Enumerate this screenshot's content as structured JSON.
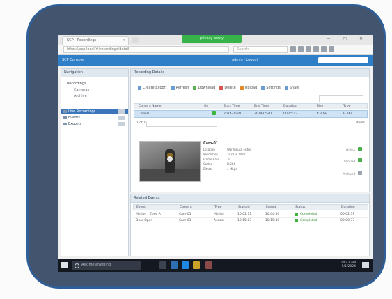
{
  "browser": {
    "tab_title": "SCP - Recordings",
    "tab_close": "×",
    "new_tab": "+",
    "proxy_label": "privacy proxy",
    "window_controls": "— ▢ ✕",
    "url": "https://scp.local/#/recordings/detail",
    "search_placeholder": "Search"
  },
  "app": {
    "logo": "SCP Console",
    "user": "admin · Logout",
    "colors": {
      "header": "#2f7fc8",
      "selection": "#3a76b9",
      "ok": "#3db53d"
    }
  },
  "sidebar": {
    "title": "Navigation",
    "tree_root": "Recordings",
    "tree_children": [
      "Cameras",
      "Archive"
    ],
    "items": [
      {
        "label": "Live Recordings",
        "active": true
      },
      {
        "label": "Events",
        "active": false
      },
      {
        "label": "Exports",
        "active": false
      }
    ]
  },
  "main": {
    "title": "Recording Details",
    "actions": [
      "Create Export",
      "Refresh",
      "Download",
      "Delete",
      "Upload",
      "Settings",
      "Share"
    ],
    "columns": [
      "Camera Name",
      "On",
      "Start Time",
      "End Time",
      "Duration",
      "Size",
      "Type"
    ],
    "row": [
      "Cam-01",
      "",
      "2024-05-01",
      "2024-05-01",
      "00:45:12",
      "4.2 GB",
      "H.264"
    ],
    "pager_label": "1 of 1",
    "pager_count": "1 items",
    "detail": {
      "title": "Cam-01",
      "fields": [
        [
          "Location",
          "Warehouse Entry"
        ],
        [
          "Resolution",
          "1920 × 1080"
        ],
        [
          "Frame Rate",
          "30"
        ],
        [
          "Codec",
          "H.264"
        ],
        [
          "Bitrate",
          "4 Mbps"
        ]
      ],
      "side_labels": [
        "Online",
        "Secured",
        "Archived"
      ]
    }
  },
  "bottom": {
    "title": "Related Events",
    "columns": [
      "Event",
      "Camera",
      "Type",
      "Started",
      "Ended",
      "Status",
      "Duration"
    ],
    "rows": [
      [
        "Motion - Zone A",
        "Cam-01",
        "Motion",
        "10:02:11",
        "10:04:50",
        "Completed",
        "00:02:39"
      ],
      [
        "Door Open",
        "Cam-01",
        "Access",
        "10:15:03",
        "10:15:40",
        "Completed",
        "00:00:37"
      ]
    ]
  },
  "taskbar": {
    "search_placeholder": "Ask me anything",
    "clock_time": "10:42 AM",
    "clock_date": "5/1/2024"
  }
}
